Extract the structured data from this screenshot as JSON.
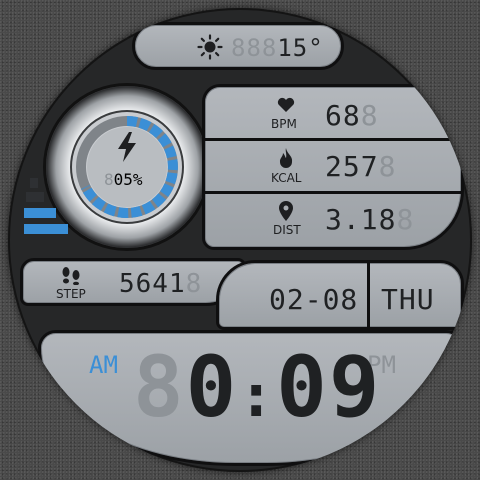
{
  "weather": {
    "ghost": "888",
    "temp": "15°",
    "icon": "sun-icon"
  },
  "battery": {
    "ghost": "8",
    "percent": "05%",
    "icon": "bolt-icon",
    "level": 0.05
  },
  "health": {
    "bpm": {
      "label": "BPM",
      "value": "68",
      "ghost": "8",
      "icon": "heart-icon"
    },
    "kcal": {
      "label": "KCAL",
      "value": "257",
      "ghost": "8",
      "icon": "flame-icon"
    },
    "dist": {
      "label": "DIST",
      "value": "3.18",
      "ghost": "8",
      "icon": "location-pin-icon"
    }
  },
  "steps": {
    "label": "STEP",
    "value": "5641",
    "ghost": "8",
    "icon": "footprints-icon"
  },
  "date": {
    "date": "02-08",
    "weekday": "THU"
  },
  "time": {
    "ghost_hour": "8",
    "hour": "0",
    "sep": ":",
    "minutes": "09",
    "am": "AM",
    "pm": "PM"
  },
  "colors": {
    "accent": "#3b8fd6",
    "panel": "#a9adb2",
    "ghost": "#8e9398"
  }
}
